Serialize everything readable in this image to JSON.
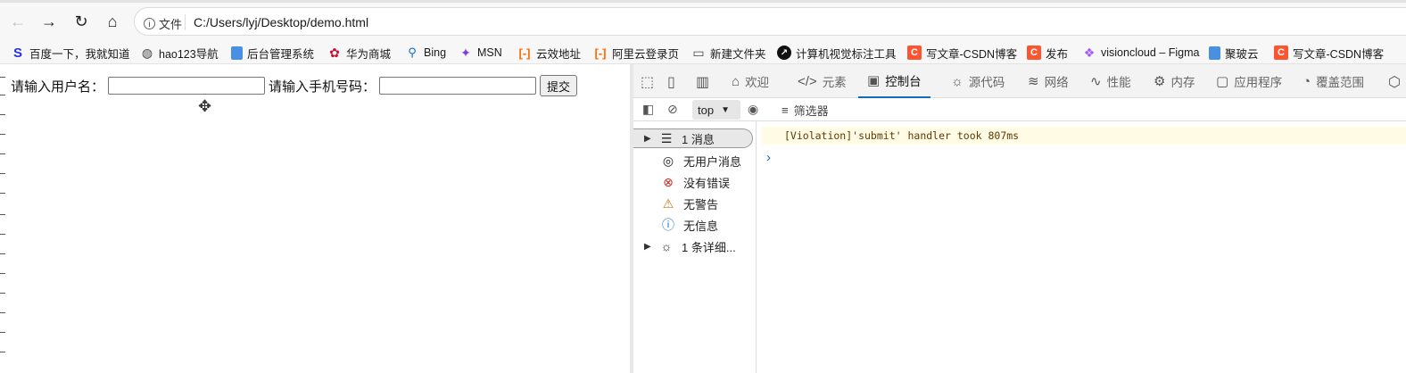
{
  "browser": {
    "back_icon": "back-arrow-icon",
    "forward_icon": "forward-arrow-icon",
    "reload_icon": "reload-icon",
    "home_icon": "home-icon",
    "file_label": "文件",
    "url": "C:/Users/lyj/Desktop/demo.html"
  },
  "bookmarks": [
    {
      "label": "百度一下，我就知道",
      "icon": "baidu-icon",
      "color": "#2932e1"
    },
    {
      "label": "hao123导航",
      "icon": "globe-icon",
      "color": "#444444"
    },
    {
      "label": "后台管理系统",
      "icon": "page-icon",
      "color": "#4a90e2"
    },
    {
      "label": "华为商城",
      "icon": "huawei-icon",
      "color": "#cf0a2c"
    },
    {
      "label": "Bing",
      "icon": "search-icon",
      "color": "#0f6cbd"
    },
    {
      "label": "MSN",
      "icon": "msn-icon",
      "color": "#7b3fe4"
    },
    {
      "label": "云效地址",
      "icon": "aliyun-icon",
      "color": "#ff6a00"
    },
    {
      "label": "阿里云登录页",
      "icon": "aliyun-icon",
      "color": "#ff6a00"
    },
    {
      "label": "新建文件夹",
      "icon": "folder-icon",
      "color": "#444444"
    },
    {
      "label": "计算机视觉标注工具",
      "icon": "arrow-circle-icon",
      "color": "#111111"
    },
    {
      "label": "写文章-CSDN博客",
      "icon": "csdn-icon",
      "color": "#fc5531"
    },
    {
      "label": "发布",
      "icon": "csdn-icon",
      "color": "#fc5531"
    },
    {
      "label": "visioncloud – Figma",
      "icon": "figma-icon",
      "color": "#a259ff"
    },
    {
      "label": "聚玻云",
      "icon": "page-icon",
      "color": "#4a90e2"
    },
    {
      "label": "写文章-CSDN博客",
      "icon": "csdn-icon",
      "color": "#fc5531"
    }
  ],
  "page": {
    "username_label": "请输入用户名：",
    "phone_label": "请输入手机号码：",
    "submit_label": "提交",
    "username_value": "",
    "phone_value": ""
  },
  "devtools": {
    "tabs": [
      {
        "label": "欢迎",
        "icon": "home-icon"
      },
      {
        "label": "元素",
        "icon": "code-icon"
      },
      {
        "label": "控制台",
        "icon": "console-icon",
        "active": true
      },
      {
        "label": "源代码",
        "icon": "bug-icon"
      },
      {
        "label": "网络",
        "icon": "wifi-icon"
      },
      {
        "label": "性能",
        "icon": "performance-icon"
      },
      {
        "label": "内存",
        "icon": "memory-icon"
      },
      {
        "label": "应用程序",
        "icon": "app-icon"
      },
      {
        "label": "覆盖范围",
        "icon": "coverage-icon"
      }
    ],
    "context": "top",
    "filter_label": "筛选器",
    "sidebar": [
      {
        "label": "1 消息",
        "icon": "list-icon",
        "expandable": true,
        "selected": true
      },
      {
        "label": "无用户消息",
        "icon": "user-icon"
      },
      {
        "label": "没有错误",
        "icon": "error-icon"
      },
      {
        "label": "无警告",
        "icon": "warning-icon"
      },
      {
        "label": "无信息",
        "icon": "info-icon"
      },
      {
        "label": "1 条详细...",
        "icon": "bug-icon",
        "expandable": true
      }
    ],
    "messages": [
      {
        "text": "[Violation]'submit' handler took 807ms",
        "level": "violation"
      }
    ]
  }
}
